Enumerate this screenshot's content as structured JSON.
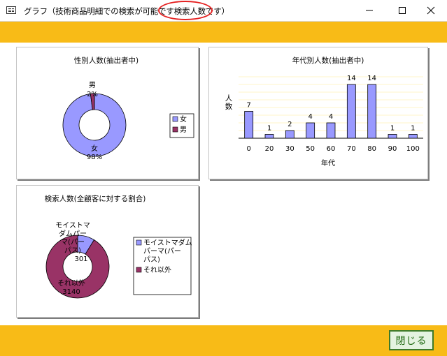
{
  "window": {
    "title": "グラフ（技術商品明細での検索が可能です",
    "title_highlight": "検索人数です）",
    "controls": [
      "minimize",
      "maximize",
      "close"
    ]
  },
  "colors": {
    "band": "#f8bb17",
    "series_a": "#9999ff",
    "series_b": "#993366"
  },
  "buttons": {
    "close_label": "閉じる"
  },
  "chart_data": [
    {
      "type": "pie",
      "title": "性別人数(抽出者中)",
      "categories": [
        "女",
        "男"
      ],
      "values": [
        98,
        2
      ],
      "data_labels": [
        {
          "name": "女",
          "pct": "98%"
        },
        {
          "name": "男",
          "pct": "2%"
        }
      ],
      "legend": [
        "女",
        "男"
      ],
      "legend_position": "right",
      "colors": [
        "#9999ff",
        "#993366"
      ],
      "style": "doughnut"
    },
    {
      "type": "bar",
      "title": "年代別人数(抽出者中)",
      "categories": [
        "0",
        "20",
        "30",
        "50",
        "60",
        "70",
        "80",
        "90",
        "100"
      ],
      "values": [
        7,
        1,
        2,
        4,
        4,
        14,
        14,
        1,
        1
      ],
      "xlabel": "年代",
      "ylabel": "人数",
      "ylim": [
        0,
        16
      ],
      "grid": true,
      "color": "#9999ff"
    },
    {
      "type": "pie",
      "title": "検索人数(全顧客に対する割合)",
      "categories": [
        "モイストマダムパーマ(パーパス)",
        "それ以外"
      ],
      "values": [
        301,
        3140
      ],
      "data_labels": [
        {
          "lines": [
            "モイストマ",
            "ダムパー",
            "マ(パー",
            "パス)",
            "301"
          ]
        },
        {
          "lines": [
            "それ以外",
            "3140"
          ]
        }
      ],
      "legend": [
        "モイストマダムパーマ(パーパス)",
        "それ以外"
      ],
      "legend_lines": [
        [
          "モイストマダム",
          "パーマ(パー",
          "パス)"
        ],
        [
          "それ以外"
        ]
      ],
      "legend_position": "right",
      "colors": [
        "#9999ff",
        "#993366"
      ],
      "style": "doughnut"
    }
  ]
}
